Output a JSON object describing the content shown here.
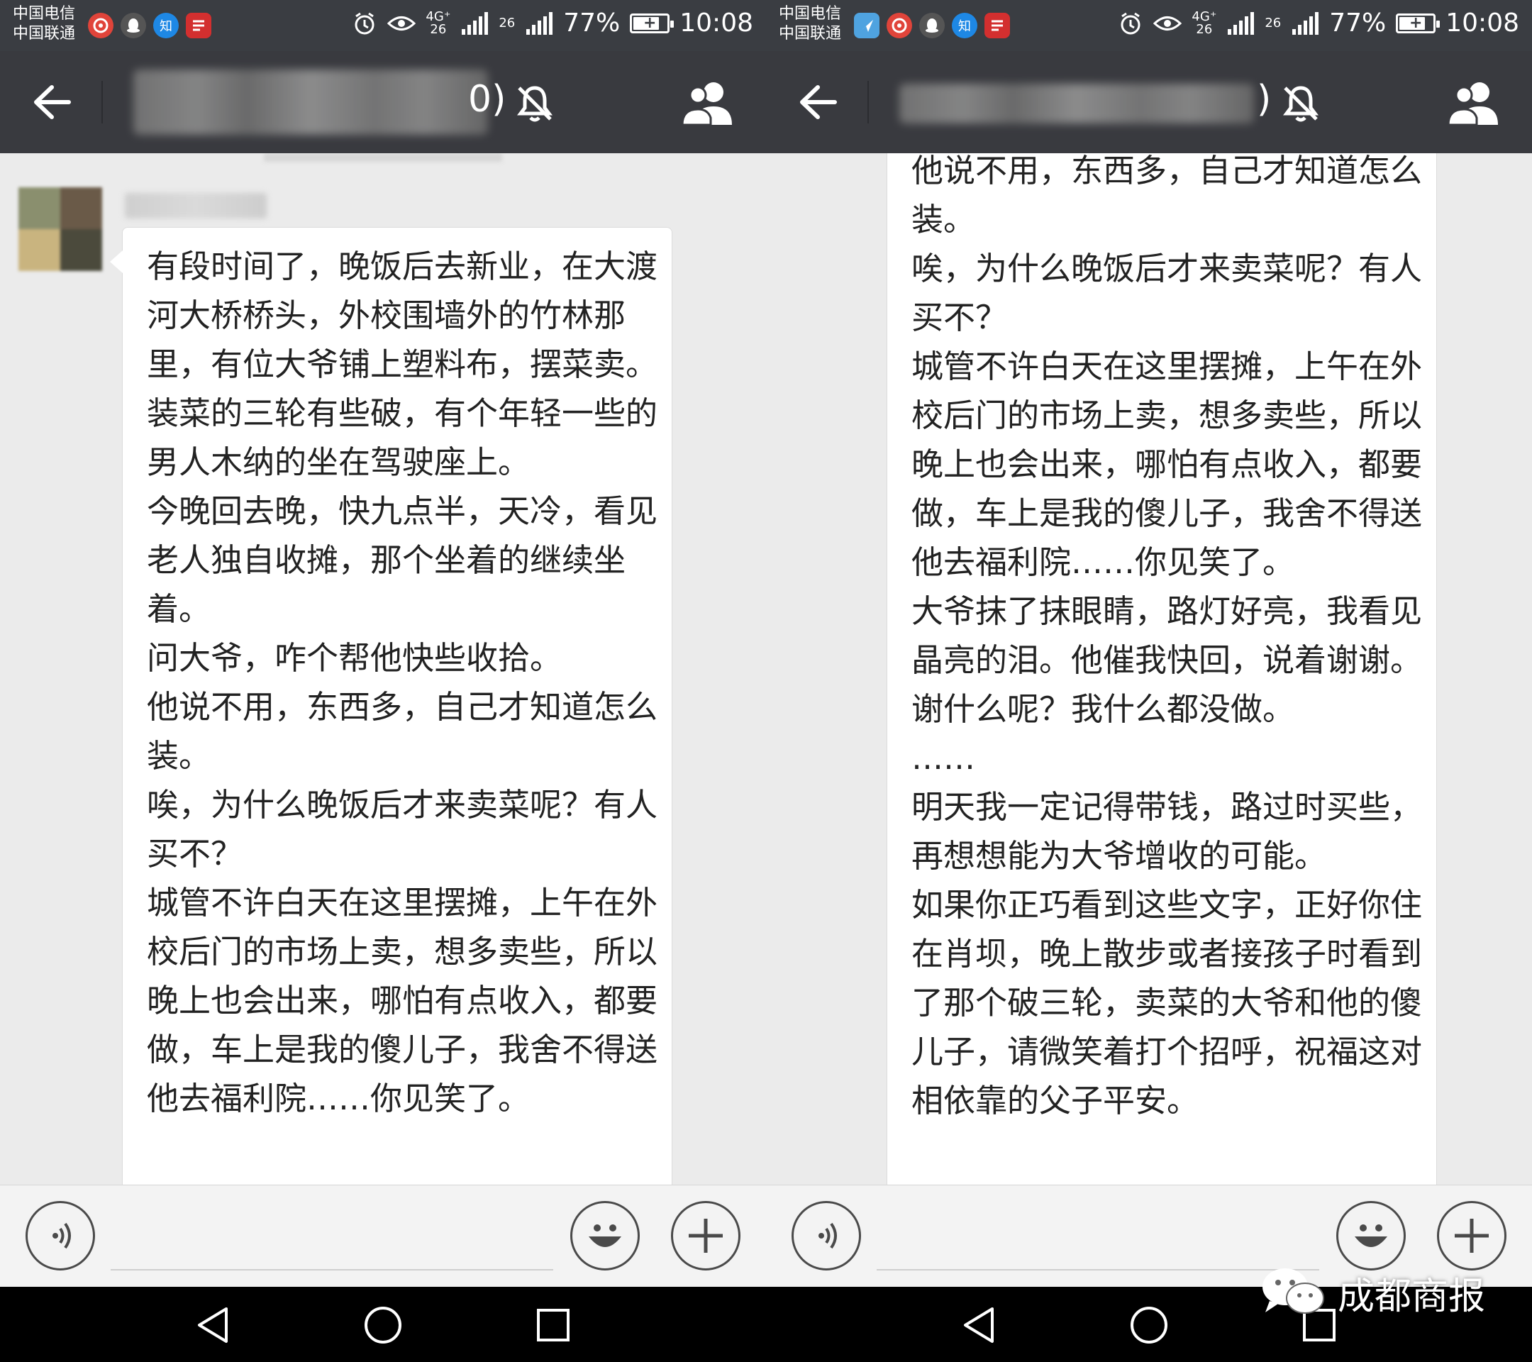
{
  "status_bar": {
    "carrier_1": "中国电信",
    "carrier_2": "中国联通",
    "battery_percent": "77%",
    "battery_level": 0.77,
    "time": "10:08",
    "net_4g": "4G⁺",
    "net_26a": "26",
    "net_26b": "26",
    "app_icons": [
      "weibo-icon",
      "qq-icon",
      "zhihu-icon",
      "news-icon"
    ],
    "app_icons_right": [
      "maps-icon",
      "weibo-icon",
      "qq-icon",
      "zhihu-icon",
      "news-icon"
    ],
    "zhihu_glyph": "知"
  },
  "chat_header": {
    "title_suffix": "0)",
    "title_suffix_right": ")"
  },
  "messages": {
    "left_text": "有段时间了，晚饭后去新业，在大渡河大桥桥头，外校围墙外的竹林那里，有位大爷铺上塑料布，摆菜卖。装菜的三轮有些破，有个年轻一些的男人木纳的坐在驾驶座上。\n今晚回去晚，快九点半，天冷，看见老人独自收摊，那个坐着的继续坐着。\n问大爷，咋个帮他快些收拾。\n他说不用，东西多，自己才知道怎么装。\n唉，为什么晚饭后才来卖菜呢？有人买不？\n城管不许白天在这里摆摊，上午在外校后门的市场上卖，想多卖些，所以晚上也会出来，哪怕有点收入，都要做，车上是我的傻儿子，我舍不得送他去福利院……你见笑了。",
    "right_text": "他说不用，东西多，自己才知道怎么装。\n唉，为什么晚饭后才来卖菜呢？有人买不？\n城管不许白天在这里摆摊，上午在外校后门的市场上卖，想多卖些，所以晚上也会出来，哪怕有点收入，都要做，车上是我的傻儿子，我舍不得送他去福利院……你见笑了。\n大爷抹了抹眼睛，路灯好亮，我看见晶亮的泪。他催我快回，说着谢谢。谢什么呢？我什么都没做。\n……\n明天我一定记得带钱，路过时买些，再想想能为大爷增收的可能。\n如果你正巧看到这些文字，正好你住在肖坝，晚上散步或者接孩子时看到了那个破三轮，卖菜的大爷和他的傻儿子，请微笑着打个招呼，祝福这对相依靠的父子平安。"
  },
  "watermark": {
    "text": "成都商报"
  },
  "colors": {
    "status_bar_bg": "#3a3d42",
    "title_bar_bg": "#393a3f",
    "chat_bg": "#ebebeb",
    "bubble_bg": "#ffffff",
    "input_bar_bg": "#f3f3f3",
    "nav_bar_bg": "#000000"
  }
}
